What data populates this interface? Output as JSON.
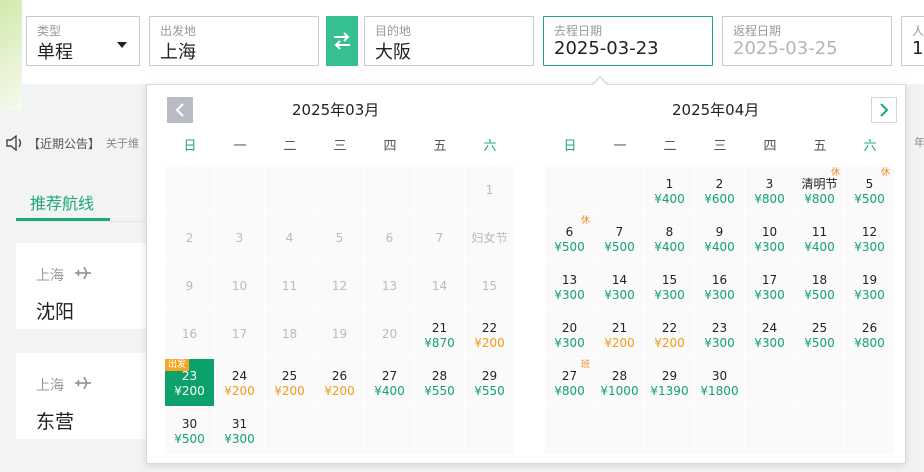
{
  "search": {
    "type": {
      "label": "类型",
      "value": "单程"
    },
    "from": {
      "label": "出发地",
      "value": "上海"
    },
    "to": {
      "label": "目的地",
      "value": "大阪"
    },
    "depart": {
      "label": "去程日期",
      "value": "2025-03-23"
    },
    "return": {
      "label": "返程日期",
      "placeholder": "2025-03-25"
    },
    "passengers": {
      "label": "人",
      "value": "1"
    }
  },
  "notice": {
    "label": "【近期公告】",
    "text": "关于维",
    "right_text": "年"
  },
  "tabs": {
    "recommended": "推荐航线"
  },
  "routes": [
    {
      "from": "上海",
      "to": "沈阳"
    },
    {
      "from": "上海",
      "to": "东营"
    }
  ],
  "weekdays": [
    "日",
    "一",
    "二",
    "三",
    "四",
    "五",
    "六"
  ],
  "months": [
    {
      "title": "2025年03月",
      "offset": 6,
      "days": [
        {
          "d": "1",
          "past": true
        },
        {
          "d": "2",
          "past": true
        },
        {
          "d": "3",
          "past": true
        },
        {
          "d": "4",
          "past": true
        },
        {
          "d": "5",
          "past": true
        },
        {
          "d": "6",
          "past": true
        },
        {
          "d": "7",
          "past": true
        },
        {
          "d": "妇女节",
          "past": true
        },
        {
          "d": "9",
          "past": true
        },
        {
          "d": "10",
          "past": true
        },
        {
          "d": "11",
          "past": true
        },
        {
          "d": "12",
          "past": true
        },
        {
          "d": "13",
          "past": true
        },
        {
          "d": "14",
          "past": true
        },
        {
          "d": "15",
          "past": true
        },
        {
          "d": "16",
          "past": true
        },
        {
          "d": "17",
          "past": true
        },
        {
          "d": "18",
          "past": true
        },
        {
          "d": "19",
          "past": true
        },
        {
          "d": "20",
          "past": true
        },
        {
          "d": "21",
          "p": "¥870",
          "c": "green"
        },
        {
          "d": "22",
          "p": "¥200",
          "c": "orange"
        },
        {
          "d": "23",
          "p": "¥200",
          "c": "green",
          "selected": true,
          "badge": "出发"
        },
        {
          "d": "24",
          "p": "¥200",
          "c": "orange"
        },
        {
          "d": "25",
          "p": "¥200",
          "c": "orange"
        },
        {
          "d": "26",
          "p": "¥200",
          "c": "orange"
        },
        {
          "d": "27",
          "p": "¥400",
          "c": "green"
        },
        {
          "d": "28",
          "p": "¥550",
          "c": "green"
        },
        {
          "d": "29",
          "p": "¥550",
          "c": "green"
        },
        {
          "d": "30",
          "p": "¥500",
          "c": "green"
        },
        {
          "d": "31",
          "p": "¥300",
          "c": "green"
        }
      ]
    },
    {
      "title": "2025年04月",
      "offset": 2,
      "days": [
        {
          "d": "1",
          "p": "¥400",
          "c": "green"
        },
        {
          "d": "2",
          "p": "¥600",
          "c": "green"
        },
        {
          "d": "3",
          "p": "¥800",
          "c": "green"
        },
        {
          "d": "清明节",
          "p": "¥800",
          "c": "green",
          "tag": "休"
        },
        {
          "d": "5",
          "p": "¥500",
          "c": "green",
          "tag": "休"
        },
        {
          "d": "6",
          "p": "¥500",
          "c": "green",
          "tag": "休"
        },
        {
          "d": "7",
          "p": "¥500",
          "c": "green"
        },
        {
          "d": "8",
          "p": "¥400",
          "c": "green"
        },
        {
          "d": "9",
          "p": "¥400",
          "c": "green"
        },
        {
          "d": "10",
          "p": "¥300",
          "c": "green"
        },
        {
          "d": "11",
          "p": "¥400",
          "c": "green"
        },
        {
          "d": "12",
          "p": "¥300",
          "c": "green"
        },
        {
          "d": "13",
          "p": "¥300",
          "c": "green"
        },
        {
          "d": "14",
          "p": "¥300",
          "c": "green"
        },
        {
          "d": "15",
          "p": "¥300",
          "c": "green"
        },
        {
          "d": "16",
          "p": "¥300",
          "c": "green"
        },
        {
          "d": "17",
          "p": "¥300",
          "c": "green"
        },
        {
          "d": "18",
          "p": "¥500",
          "c": "green"
        },
        {
          "d": "19",
          "p": "¥300",
          "c": "green"
        },
        {
          "d": "20",
          "p": "¥300",
          "c": "green"
        },
        {
          "d": "21",
          "p": "¥200",
          "c": "orange"
        },
        {
          "d": "22",
          "p": "¥200",
          "c": "orange"
        },
        {
          "d": "23",
          "p": "¥300",
          "c": "green"
        },
        {
          "d": "24",
          "p": "¥300",
          "c": "green"
        },
        {
          "d": "25",
          "p": "¥500",
          "c": "green"
        },
        {
          "d": "26",
          "p": "¥800",
          "c": "green"
        },
        {
          "d": "27",
          "p": "¥800",
          "c": "green",
          "tag": "班"
        },
        {
          "d": "28",
          "p": "¥1000",
          "c": "green"
        },
        {
          "d": "29",
          "p": "¥1390",
          "c": "green"
        },
        {
          "d": "30",
          "p": "¥1800",
          "c": "green"
        }
      ]
    }
  ],
  "colors": {
    "accent": "#1fa67a",
    "selected": "#0da16b",
    "price_low": "#f29b16",
    "price_normal": "#13a36a"
  },
  "icons": {
    "swap": "swap-arrows-icon",
    "prev": "chevron-left-icon",
    "next": "chevron-right-icon",
    "notice": "speaker-icon",
    "plane": "plane-icon",
    "dropdown": "caret-down-icon"
  }
}
